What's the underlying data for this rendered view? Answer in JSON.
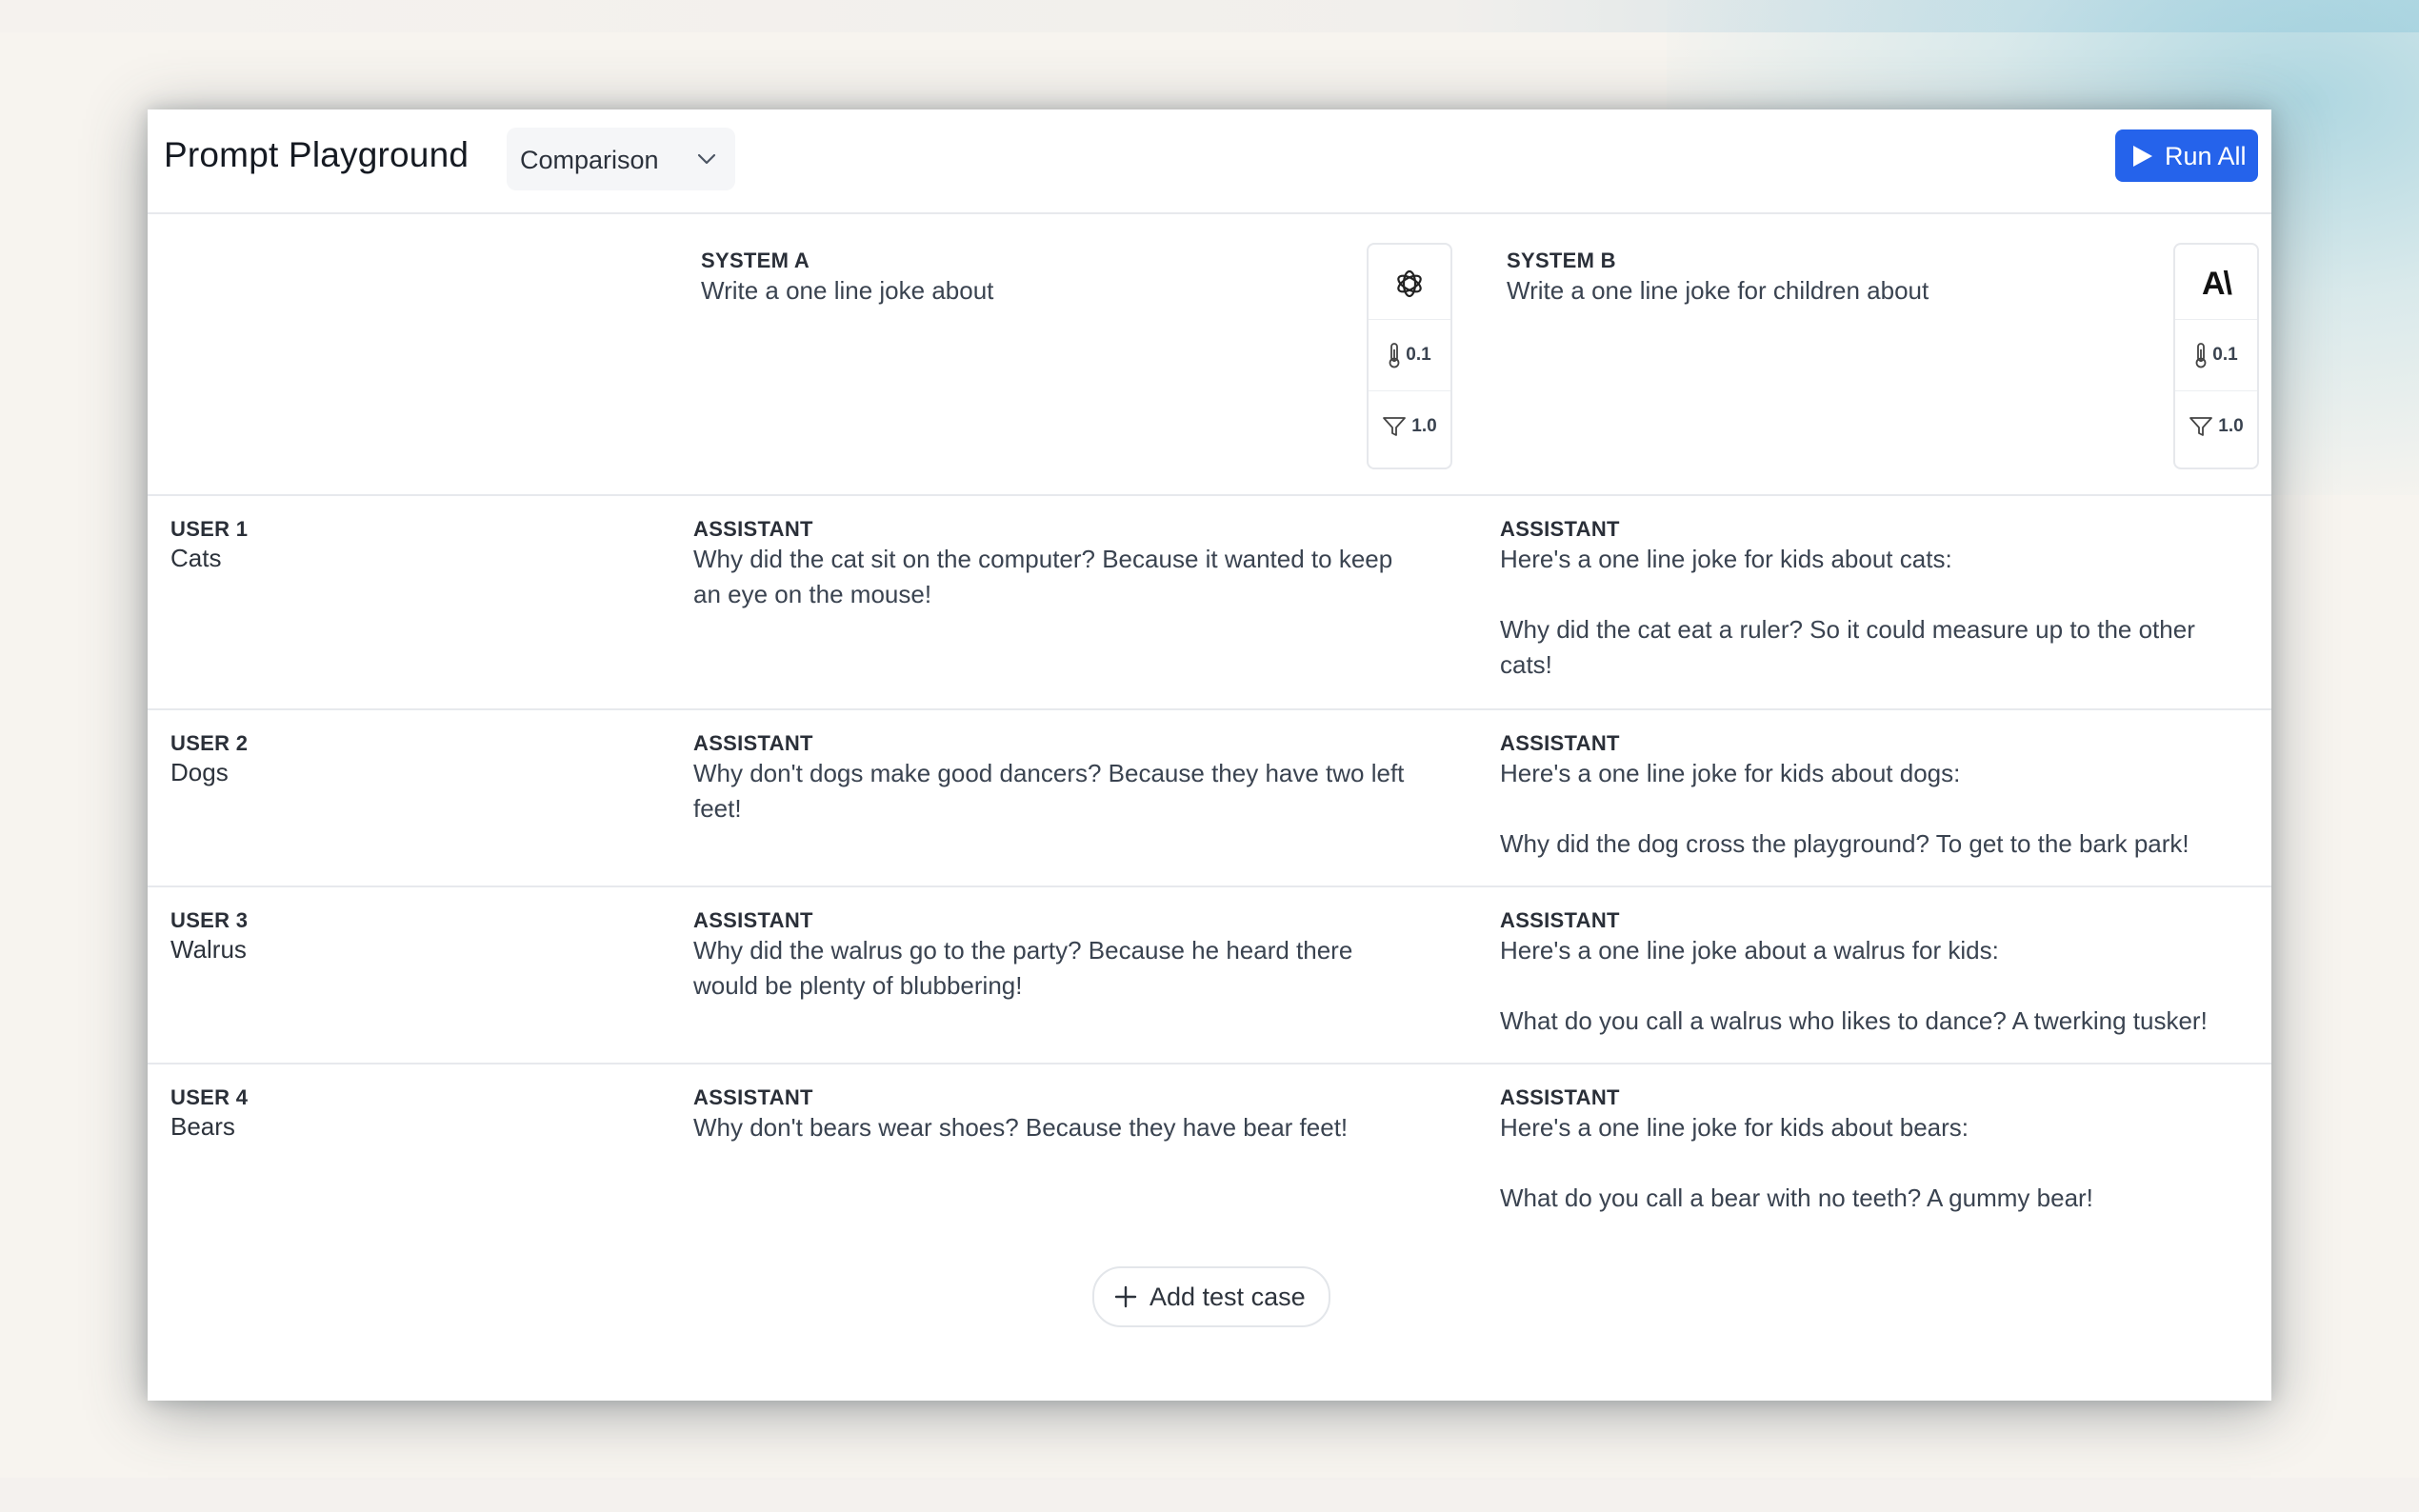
{
  "app": {
    "title": "Prompt Playground",
    "mode": "Comparison",
    "run_label": "Run All"
  },
  "systems": [
    {
      "label": "SYSTEM A",
      "prompt": "Write a one line joke about",
      "temperature": "0.1",
      "top_p": "1.0",
      "model_icon": "openai-icon"
    },
    {
      "label": "SYSTEM B",
      "prompt": "Write a one line joke for children about",
      "temperature": "0.1",
      "top_p": "1.0",
      "model_icon": "anthropic-icon",
      "model_logo_text": "A\\"
    }
  ],
  "cases": [
    {
      "user_label": "USER 1",
      "user_text": "Cats",
      "a_label": "ASSISTANT",
      "a_lines": [
        "Why did the cat sit on the computer? Because it wanted to keep",
        "an eye on the mouse!"
      ],
      "b_label": "ASSISTANT",
      "b_lines": [
        "Here's a one line joke for kids about cats:",
        "",
        "Why did the cat eat a ruler? So it could measure up to the other",
        "cats!"
      ]
    },
    {
      "user_label": "USER 2",
      "user_text": "Dogs",
      "a_label": "ASSISTANT",
      "a_lines": [
        "Why don't dogs make good dancers? Because they have two left",
        "feet!"
      ],
      "b_label": "ASSISTANT",
      "b_lines": [
        "Here's a one line joke for kids about dogs:",
        "",
        "Why did the dog cross the playground? To get to the bark park!"
      ]
    },
    {
      "user_label": "USER 3",
      "user_text": "Walrus",
      "a_label": "ASSISTANT",
      "a_lines": [
        "Why did the walrus go to the party? Because he heard there",
        "would be plenty of blubbering!"
      ],
      "b_label": "ASSISTANT",
      "b_lines": [
        "Here's a one line joke about a walrus for kids:",
        "",
        "What do you call a walrus who likes to dance? A twerking tusker!"
      ]
    },
    {
      "user_label": "USER 4",
      "user_text": "Bears",
      "a_label": "ASSISTANT",
      "a_lines": [
        "Why don't bears wear shoes? Because they have bear feet!"
      ],
      "b_label": "ASSISTANT",
      "b_lines": [
        "Here's a one line joke for kids about bears:",
        "",
        "What do you call a bear with no teeth? A gummy bear!"
      ]
    }
  ],
  "add_label": "Add test case",
  "colors": {
    "accent": "#2563eb",
    "border": "#e7e9ed",
    "text": "#3a4350"
  }
}
